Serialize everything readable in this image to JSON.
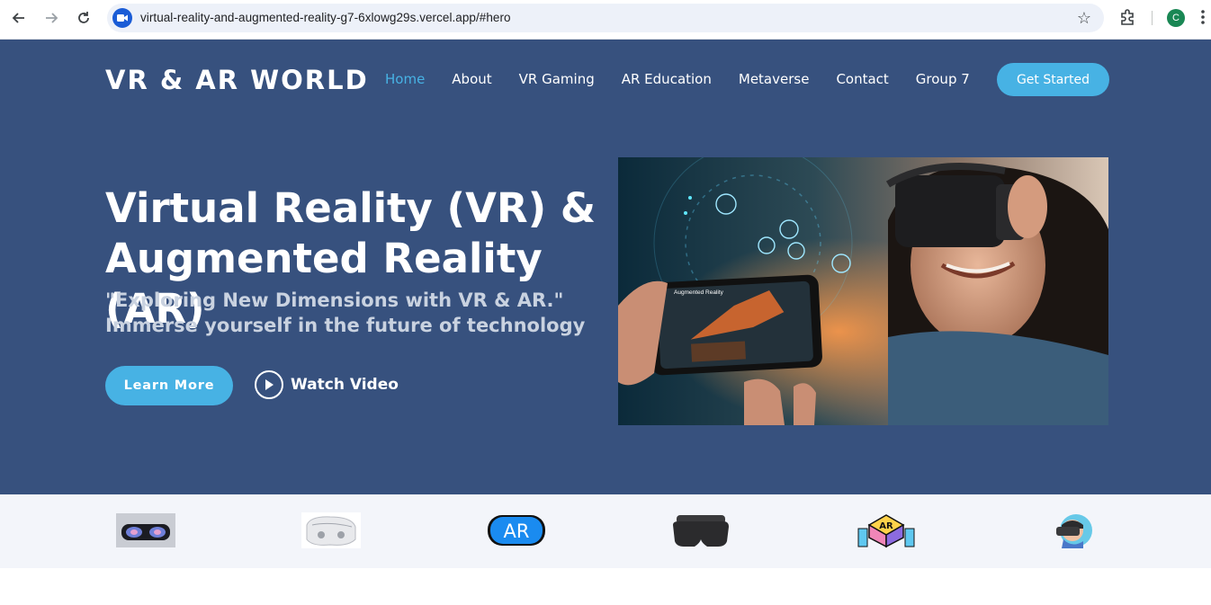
{
  "browser": {
    "url": "virtual-reality-and-augmented-reality-g7-6xlowg29s.vercel.app/#hero",
    "profile_initial": "C",
    "icons": [
      "back-icon",
      "forward-icon",
      "reload-icon",
      "site-icon",
      "star-icon",
      "extensions-icon",
      "kebab-icon"
    ]
  },
  "header": {
    "logo": "VR & AR WORLD",
    "menu": [
      {
        "label": "Home",
        "active": true
      },
      {
        "label": "About",
        "active": false
      },
      {
        "label": "VR Gaming",
        "active": false
      },
      {
        "label": "AR Education",
        "active": false
      },
      {
        "label": "Metaverse",
        "active": false
      },
      {
        "label": "Contact",
        "active": false
      },
      {
        "label": "Group 7",
        "active": false
      }
    ],
    "cta": "Get Started"
  },
  "hero": {
    "title_line1": "Virtual Reality (VR) &",
    "title_line2": "Augmented Reality (AR)",
    "subtitle_line1": "\"Exploring New Dimensions with VR & AR.\"",
    "subtitle_line2": "Immerse yourself in the future of technology",
    "learn_more": "Learn More",
    "watch_video": "Watch Video",
    "image_caption": "Augmented Reality"
  },
  "clients": {
    "items": [
      "vr-headset-front-logo",
      "white-vr-headset-logo",
      "ar-badge-logo",
      "black-vr-headset-logo",
      "ar-cube-logo",
      "person-vr-logo"
    ],
    "ar_badge_text": "AR",
    "ar_cube_text": "AR"
  },
  "colors": {
    "hero_bg": "#37517e",
    "accent": "#47b2e4",
    "clients_bg": "#f3f5fa"
  }
}
